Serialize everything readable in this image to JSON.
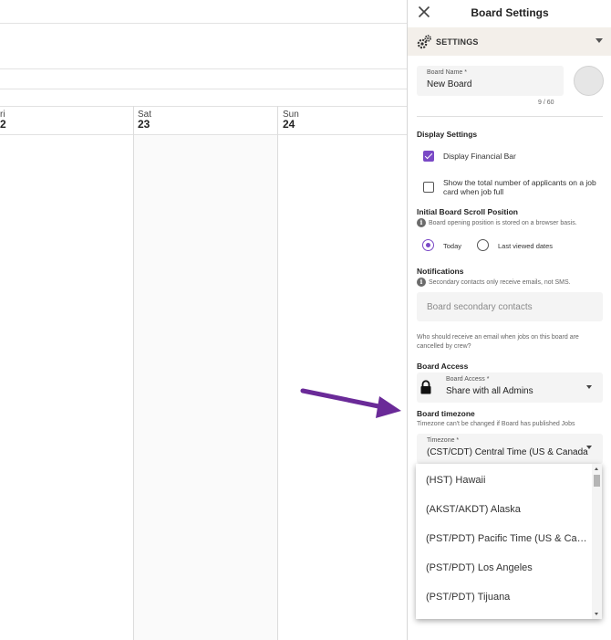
{
  "calendar": {
    "days": [
      {
        "weekday": "ri",
        "date": "2"
      },
      {
        "weekday": "Sat",
        "date": "23"
      },
      {
        "weekday": "Sun",
        "date": "24"
      }
    ]
  },
  "panel": {
    "title": "Board Settings",
    "settings_section": "SETTINGS",
    "board_name": {
      "label": "Board Name *",
      "value": "New Board",
      "counter": "9 / 60"
    },
    "display_settings": {
      "title": "Display Settings",
      "financial_bar": {
        "label": "Display Financial Bar",
        "checked": true
      },
      "applicants": {
        "label": "Show the total number of applicants on a job card when job full",
        "checked": false
      }
    },
    "scroll_position": {
      "title": "Initial Board Scroll Position",
      "helper": "Board opening position is stored on a browser basis.",
      "options": [
        "Today",
        "Last viewed dates"
      ],
      "selected": "Today"
    },
    "notifications": {
      "title": "Notifications",
      "helper": "Secondary contacts only receive emails, not SMS.",
      "secondary_contacts_placeholder": "Board secondary contacts",
      "cancel_helper": "Who should receive an email when jobs on this board are cancelled by crew?"
    },
    "board_access": {
      "title": "Board Access",
      "field_label": "Board Access *",
      "value": "Share with all Admins"
    },
    "timezone": {
      "title": "Board timezone",
      "helper": "Timezone can't be changed if Board has published Jobs",
      "field_label": "Timezone *",
      "value": "(CST/CDT) Central Time (US & Canada",
      "options": [
        "(HST) Hawaii",
        "(AKST/AKDT) Alaska",
        "(PST/PDT) Pacific Time (US & Canada)",
        "(PST/PDT) Los Angeles",
        "(PST/PDT) Tijuana"
      ]
    }
  },
  "colors": {
    "accent": "#7a49c6",
    "annotation_arrow": "#6a2a98",
    "settings_bar": "#f3efea"
  },
  "icons": {
    "close": "close-icon",
    "settings": "gears-icon",
    "lock": "lock-icon",
    "info": "info-icon"
  }
}
